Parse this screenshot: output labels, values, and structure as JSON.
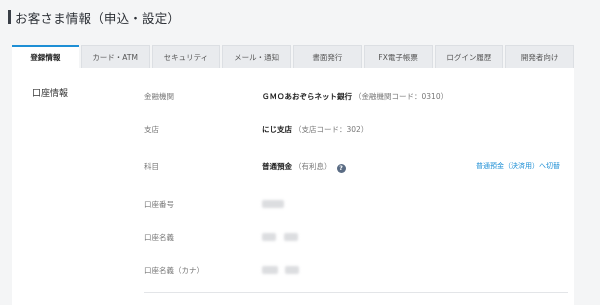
{
  "page": {
    "title": "お客さま情報（申込・設定）"
  },
  "tabs": [
    {
      "label": "登録情報",
      "active": true
    },
    {
      "label": "カード・ATM",
      "active": false
    },
    {
      "label": "セキュリティ",
      "active": false
    },
    {
      "label": "メール・通知",
      "active": false
    },
    {
      "label": "書面発行",
      "active": false
    },
    {
      "label": "FX電子帳票",
      "active": false
    },
    {
      "label": "ログイン履歴",
      "active": false
    },
    {
      "label": "開発者向け",
      "active": false
    }
  ],
  "account_info": {
    "section_label": "口座情報",
    "bank": {
      "label": "金融機関",
      "value": "ＧＭＯあおぞらネット銀行",
      "code": "（金融機関コード：0310）"
    },
    "branch": {
      "label": "支店",
      "value": "にじ支店",
      "code": "（支店コード：302）"
    },
    "subject": {
      "label": "科目",
      "value": "普通預金",
      "note": "（有利息）",
      "help_icon": "question-circle-icon",
      "switch_link": "普通預金（決済用）へ切替"
    },
    "account_number": {
      "label": "口座番号"
    },
    "account_name": {
      "label": "口座名義"
    },
    "account_name_kana": {
      "label": "口座名義（カナ）"
    }
  },
  "colors": {
    "accent": "#1e8fd5",
    "header_bar": "#3a3f47",
    "background": "#f4f5f6"
  }
}
